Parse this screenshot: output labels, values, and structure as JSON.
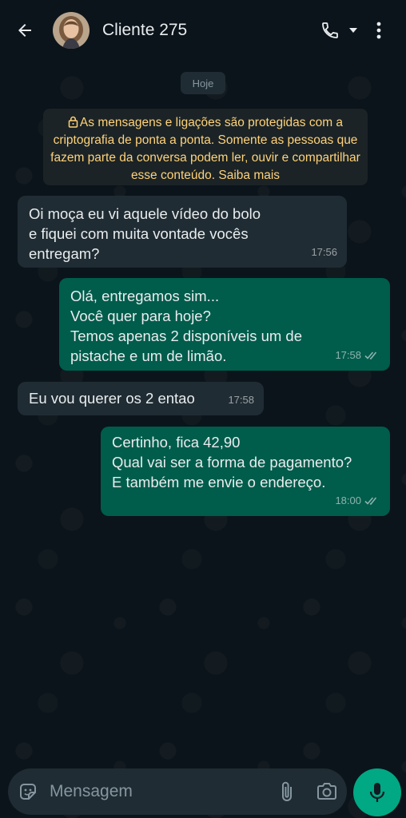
{
  "header": {
    "contact_name": "Cliente 275"
  },
  "chat": {
    "date_chip": "Hoje",
    "encryption_notice": "As mensagens e ligações são protegidas com a criptografia de ponta a ponta. Somente as pessoas que fazem parte da conversa podem ler, ouvir e compartilhar esse conteúdo. Saiba mais",
    "messages": [
      {
        "direction": "in",
        "text": "Oi moça eu vi aquele vídeo do bolo\ne fiquei com muita vontade vocês\nentregam?",
        "time": "17:56"
      },
      {
        "direction": "out",
        "text": "Olá, entregamos sim...\nVocê quer para hoje?\nTemos apenas 2 disponíveis um de\npistache e um de limão.",
        "time": "17:58",
        "status": "read"
      },
      {
        "direction": "in",
        "text": "Eu vou querer os 2 entao",
        "time": "17:58"
      },
      {
        "direction": "out",
        "text": "Certinho, fica 42,90\nQual vai ser a forma de pagamento?\nE também me envie o endereço.",
        "time": "18:00",
        "status": "read"
      }
    ]
  },
  "composer": {
    "placeholder": "Mensagem"
  },
  "icons": {
    "back": "back-arrow-icon",
    "call": "phone-icon",
    "call_menu": "dropdown-caret-icon",
    "menu": "more-vertical-icon",
    "lock": "lock-icon",
    "emoji": "sticker-emoji-icon",
    "attach": "paperclip-icon",
    "camera": "camera-icon",
    "mic": "microphone-icon",
    "read_receipt": "double-check-icon"
  },
  "colors": {
    "background": "#0b141a",
    "incoming_bubble": "#202c33",
    "outgoing_bubble": "#005c4b",
    "notice_text": "#ffd279",
    "accent": "#00a884"
  }
}
